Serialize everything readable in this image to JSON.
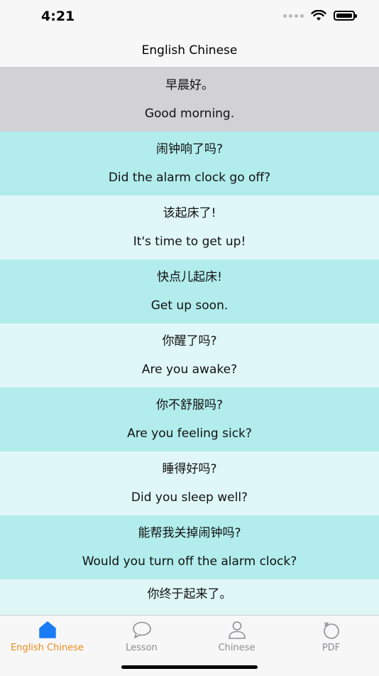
{
  "status": {
    "time": "4:21"
  },
  "nav": {
    "title": "English Chinese"
  },
  "rows": [
    {
      "zh": "早晨好。",
      "en": "Good morning."
    },
    {
      "zh": "闹钟响了吗?",
      "en": "Did the alarm clock go off?"
    },
    {
      "zh": "该起床了!",
      "en": "It's time to get up!"
    },
    {
      "zh": "快点儿起床!",
      "en": "Get up soon."
    },
    {
      "zh": "你醒了吗?",
      "en": "Are you awake?"
    },
    {
      "zh": "你不舒服吗?",
      "en": "Are you feeling sick?"
    },
    {
      "zh": "睡得好吗?",
      "en": "Did you sleep well?"
    },
    {
      "zh": "能帮我关掉闹钟吗?",
      "en": "Would you turn off the alarm clock?"
    },
    {
      "zh": "你终于起来了。",
      "en": ""
    }
  ],
  "tabs": [
    {
      "label": "English Chinese",
      "icon": "home-icon"
    },
    {
      "label": "Lesson",
      "icon": "chat-bubble-icon"
    },
    {
      "label": "Chinese",
      "icon": "person-icon"
    },
    {
      "label": "PDF",
      "icon": "ring-icon"
    }
  ],
  "colors": {
    "accent": "#f08a1c",
    "row_dark": "#b2ecec",
    "row_light": "#e0f7f7",
    "row_selected": "#d1d1d6",
    "active_icon": "#1a7cf5"
  }
}
